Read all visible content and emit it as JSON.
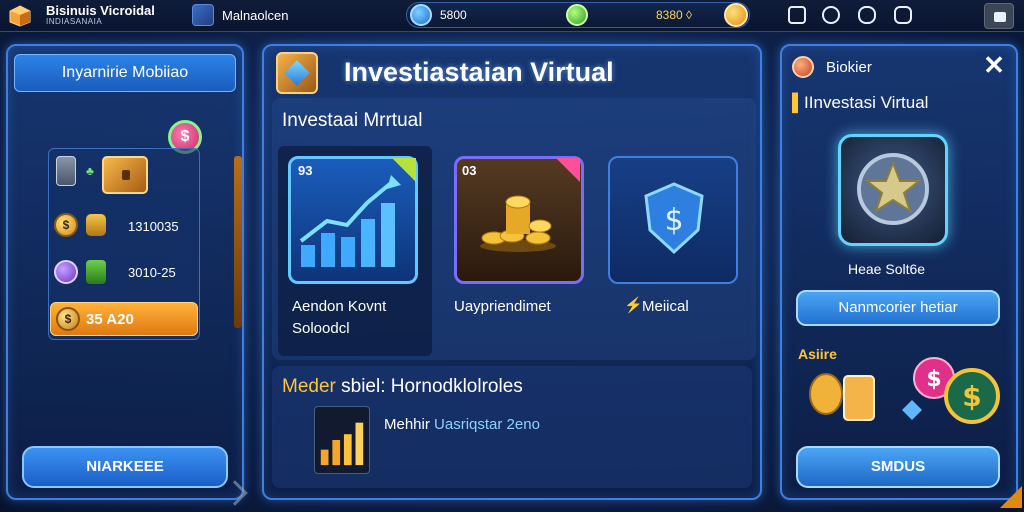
{
  "topbar": {
    "app_title": "Bisinuis Vicroidal",
    "app_subtitle": "INDIASANAIA",
    "tab_label": "Malnaolcen",
    "currency_blue": "5800",
    "currency_gold": "8380 ◊"
  },
  "left_panel": {
    "header": "Inyarnirie Mobiiao",
    "rows": [
      {
        "value": "1310035"
      },
      {
        "value": "3010-25"
      }
    ],
    "selected_row": "35  A20",
    "button": "NIARKEEE"
  },
  "center_panel": {
    "title": "Investiastaian Virtual",
    "subtitle": "Investaai Mrrtual",
    "cards": [
      {
        "number": "93",
        "label_line1": "Aendon Kovnt",
        "label_line2": "Soloodcl"
      },
      {
        "number": "03",
        "label_line1": "Uaypriendimet"
      },
      {
        "label_line1": "Meiical"
      }
    ],
    "bottom": {
      "heading_prefix": "Meder",
      "heading_rest": " sbiel: Hornodklolroles",
      "line_prefix": "Mehhir ",
      "line_highlight": "Uasriqstar 2eno"
    }
  },
  "right_panel": {
    "title": "Biokier",
    "subtitle": "IInvestasi Virtual",
    "safe_caption": "Heae Solt6e",
    "button": "Nanmcorier hetiar",
    "assets_label": "Asiire",
    "button2": "SMDUS"
  }
}
